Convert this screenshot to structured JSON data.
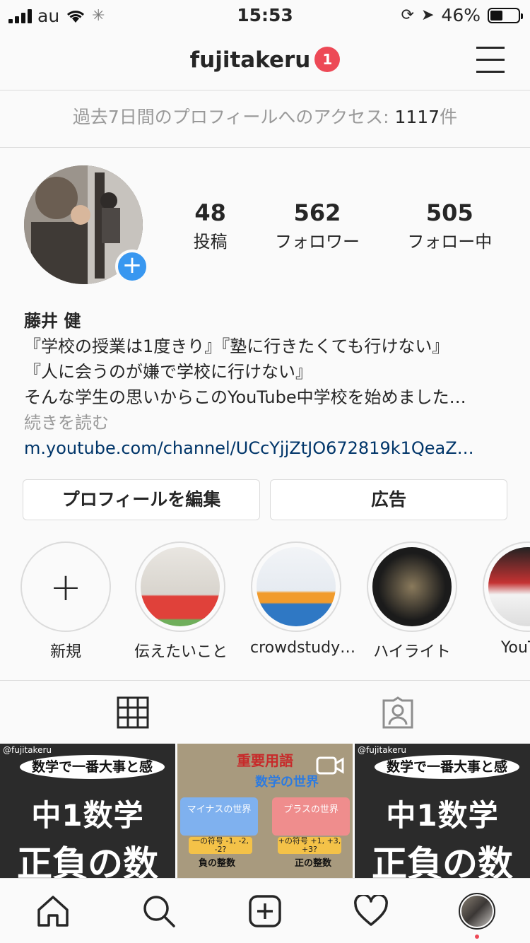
{
  "status": {
    "carrier": "au",
    "time": "15:53",
    "battery": "46%",
    "battery_level": 0.46
  },
  "header": {
    "username": "fujitakeru",
    "notification_count": "1"
  },
  "insights": {
    "label": "過去7日間のプロフィールへのアクセス: ",
    "value": "1117",
    "unit": "件"
  },
  "profile": {
    "stats": [
      {
        "value": "48",
        "label": "投稿"
      },
      {
        "value": "562",
        "label": "フォロワー"
      },
      {
        "value": "505",
        "label": "フォロー中"
      }
    ],
    "name": "藤井 健",
    "bio": [
      "『学校の授業は1度きり』『塾に行きたくても行けない』",
      "『人に会うのが嫌で学校に行けない』",
      "そんな学生の思いからこのYouTube中学校を始めました…"
    ],
    "more": "続きを読む",
    "link": "m.youtube.com/channel/UCcYjjZtJO672819k1QeaZ…"
  },
  "buttons": {
    "edit_profile": "プロフィールを編集",
    "ads": "広告"
  },
  "highlights": [
    {
      "label": "新規"
    },
    {
      "label": "伝えたいこと"
    },
    {
      "label": "crowdstudy…"
    },
    {
      "label": "ハイライト"
    },
    {
      "label": "YouTub"
    }
  ],
  "grid": {
    "watermark": "@fujitakeru",
    "post1": {
      "bubble": "数学で一番大事と感",
      "line1": "中1数学",
      "line2": "正負の数"
    },
    "post2": {
      "title": "重要用語",
      "sub": "数学の世界",
      "left_box": "マイナスの世界",
      "right_box": "プラスの世界",
      "left_tag": "一の符号 -1, -2, -2?",
      "right_tag": "+の符号 +1, +3, +3?",
      "left_cap": "負の整数",
      "right_cap": "正の整数"
    },
    "post3": {
      "bubble": "数学で一番大事と感",
      "line1": "中1数学",
      "line2": "正負の数"
    }
  }
}
